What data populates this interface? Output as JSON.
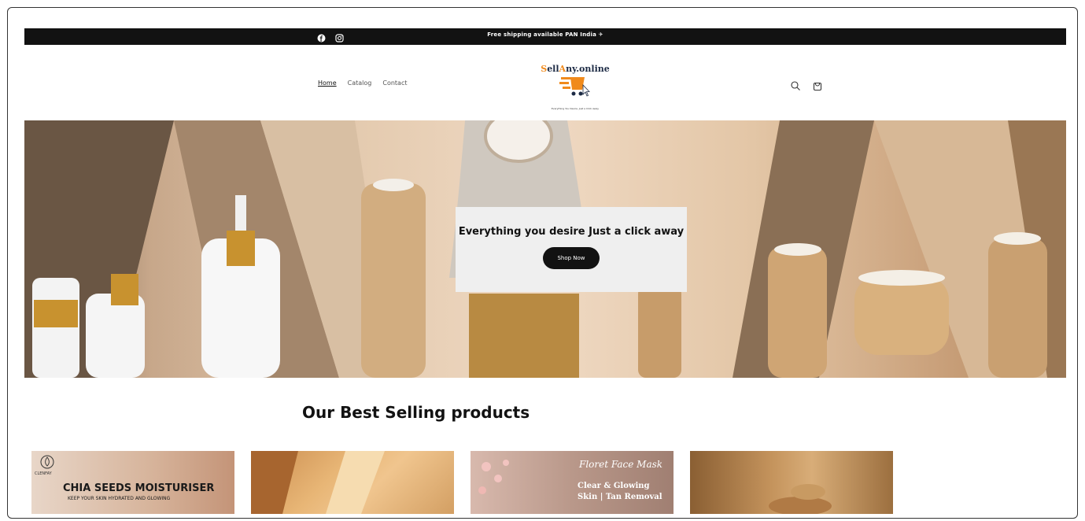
{
  "announcement": {
    "message": "Free shipping available PAN India ✈"
  },
  "header": {
    "nav": [
      {
        "label": "Home",
        "active": true
      },
      {
        "label": "Catalog",
        "active": false
      },
      {
        "label": "Contact",
        "active": false
      }
    ],
    "logo": {
      "brand_s": "S",
      "brand_ell": "ell",
      "brand_a": "A",
      "brand_rest": "ny.online",
      "tagline": "Everything You Desire, Just a Click Away"
    }
  },
  "hero": {
    "heading": "Everything you desire Just a click away",
    "button_label": "Shop Now"
  },
  "section": {
    "title": "Our Best Selling products"
  },
  "cards": {
    "card1_brand": "CLENFAY",
    "card1_title": "CHIA SEEDS MOISTURISER",
    "card1_subtitle": "KEEP YOUR SKIN HYDRATED AND GLOWING",
    "card3_script": "Floret Face Mask",
    "card3_line1": "Clear & Glowing",
    "card3_line2": "Skin | Tan Removal"
  },
  "colors": {
    "announcement_bg": "#121212",
    "accent_orange": "#f08a1c",
    "hero_box_bg": "#efefef"
  }
}
